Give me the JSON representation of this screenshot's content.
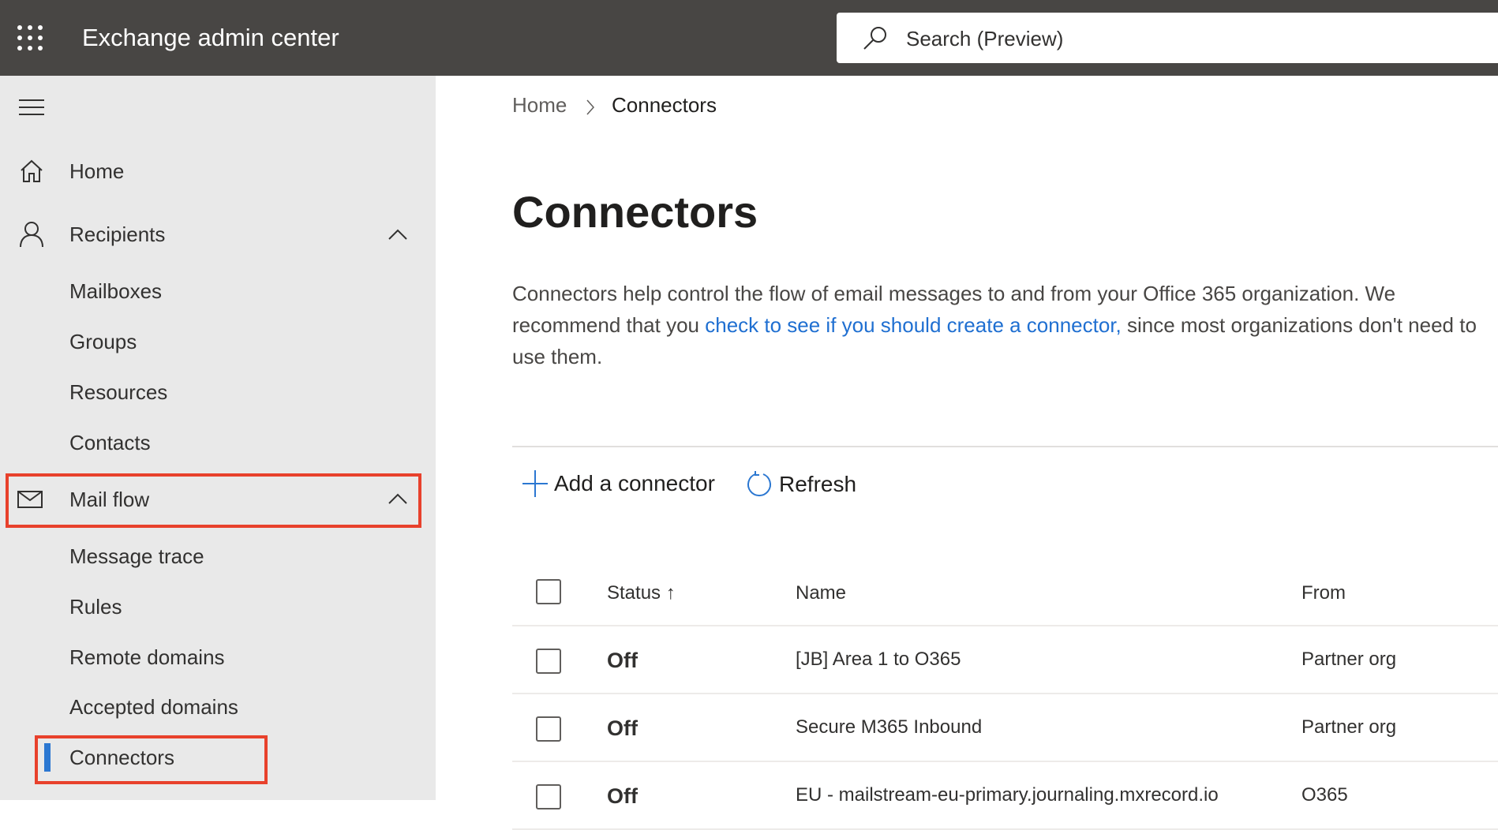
{
  "app": {
    "title": "Exchange admin center",
    "search_placeholder": "Search (Preview)"
  },
  "sidebar": {
    "home": "Home",
    "recipients": {
      "label": "Recipients",
      "children": [
        "Mailboxes",
        "Groups",
        "Resources",
        "Contacts"
      ]
    },
    "mail_flow": {
      "label": "Mail flow",
      "children": [
        "Message trace",
        "Rules",
        "Remote domains",
        "Accepted domains",
        "Connectors"
      ]
    }
  },
  "breadcrumb": [
    "Home",
    "Connectors"
  ],
  "page": {
    "title": "Connectors",
    "desc_before": "Connectors help control the flow of email messages to and from your Office 365 organization. We recommend that you ",
    "desc_link": "check to see if you should create a connector,",
    "desc_after": " since most organizations don't need to use them."
  },
  "toolbar": {
    "add": "Add a connector",
    "refresh": "Refresh"
  },
  "table": {
    "columns": [
      "Status",
      "Name",
      "From"
    ],
    "rows": [
      {
        "status": "Off",
        "name": "[JB] Area 1 to O365",
        "from": "Partner org"
      },
      {
        "status": "Off",
        "name": "Secure M365 Inbound",
        "from": "Partner org"
      },
      {
        "status": "Off",
        "name": "EU - mailstream-eu-primary.journaling.mxrecord.io",
        "from": "O365"
      }
    ]
  },
  "colors": {
    "accent": "#2b77d1",
    "highlight": "#e8412c",
    "topbar": "#484644"
  }
}
